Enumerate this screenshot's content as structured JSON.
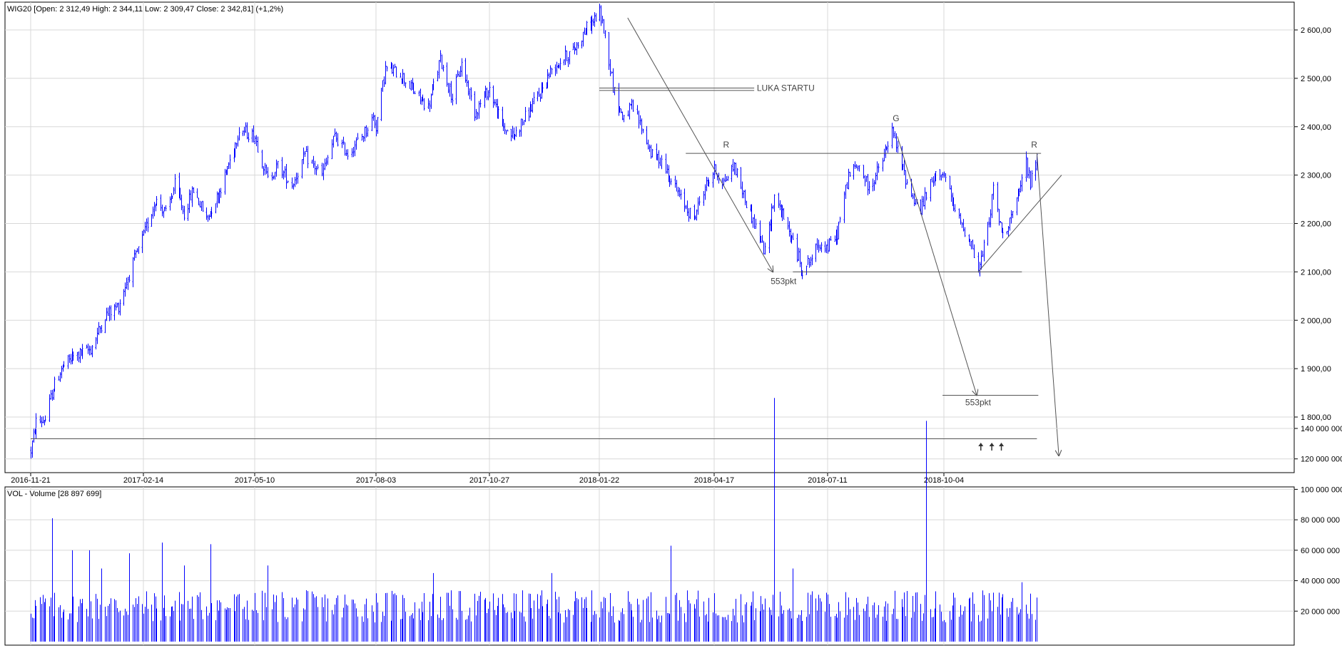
{
  "price_panel": {
    "header": "WIG20 [Open: 2 312,49  High: 2 344,11  Low: 2 309,47  Close: 2 342,81] (+1,2%)"
  },
  "volume_panel": {
    "header": "VOL - Volume [28 897 699]"
  },
  "colors": {
    "series": "#0000ff",
    "grid": "#d8d8d8",
    "annotation_line": "#555555",
    "frame": "#000000"
  },
  "chart_data": [
    {
      "type": "candlestick",
      "title": "WIG20 [Open: 2 312,49  High: 2 344,11  Low: 2 309,47  Close: 2 342,81] (+1,2%)",
      "x_ticks": [
        "2016-11-21",
        "2017-02-14",
        "2017-05-10",
        "2017-08-03",
        "2017-10-27",
        "2018-01-22",
        "2018-04-17",
        "2018-07-11",
        "2018-10-04"
      ],
      "y_ticks": [
        1800,
        1900,
        2000,
        2100,
        2200,
        2300,
        2400,
        2500,
        2600
      ],
      "y_tick_labels": [
        "1 800,00",
        "1 900,00",
        "2 000,00",
        "2 100,00",
        "2 200,00",
        "2 300,00",
        "2 400,00",
        "2 500,00",
        "2 600,00"
      ],
      "ylim": [
        1690,
        2665
      ],
      "grid": true,
      "last_bar": {
        "date": "2018-12-11",
        "open": 2312.49,
        "high": 2344.11,
        "low": 2309.47,
        "close": 2342.81,
        "change_pct": "+1,2%"
      },
      "path_anchors": [
        [
          "2016-11-21",
          1730
        ],
        [
          "2016-11-25",
          1790
        ],
        [
          "2016-12-02",
          1795
        ],
        [
          "2016-12-08",
          1860
        ],
        [
          "2016-12-14",
          1900
        ],
        [
          "2016-12-23",
          1925
        ],
        [
          "2017-01-05",
          1940
        ],
        [
          "2017-01-16",
          2010
        ],
        [
          "2017-01-26",
          2030
        ],
        [
          "2017-02-01",
          2080
        ],
        [
          "2017-02-14",
          2175
        ],
        [
          "2017-02-23",
          2250
        ],
        [
          "2017-03-03",
          2220
        ],
        [
          "2017-03-10",
          2280
        ],
        [
          "2017-03-17",
          2220
        ],
        [
          "2017-03-24",
          2270
        ],
        [
          "2017-04-03",
          2210
        ],
        [
          "2017-04-12",
          2260
        ],
        [
          "2017-04-21",
          2330
        ],
        [
          "2017-04-28",
          2395
        ],
        [
          "2017-05-10",
          2380
        ],
        [
          "2017-05-19",
          2290
        ],
        [
          "2017-05-26",
          2320
        ],
        [
          "2017-06-05",
          2280
        ],
        [
          "2017-06-14",
          2340
        ],
        [
          "2017-06-26",
          2300
        ],
        [
          "2017-07-05",
          2380
        ],
        [
          "2017-07-14",
          2345
        ],
        [
          "2017-07-24",
          2380
        ],
        [
          "2017-08-01",
          2420
        ],
        [
          "2017-08-03",
          2400
        ],
        [
          "2017-08-10",
          2520
        ],
        [
          "2017-08-21",
          2510
        ],
        [
          "2017-09-01",
          2470
        ],
        [
          "2017-09-11",
          2440
        ],
        [
          "2017-09-20",
          2540
        ],
        [
          "2017-09-29",
          2460
        ],
        [
          "2017-10-06",
          2530
        ],
        [
          "2017-10-16",
          2430
        ],
        [
          "2017-10-27",
          2480
        ],
        [
          "2017-11-06",
          2400
        ],
        [
          "2017-11-15",
          2380
        ],
        [
          "2017-11-24",
          2420
        ],
        [
          "2017-12-06",
          2470
        ],
        [
          "2017-12-15",
          2520
        ],
        [
          "2018-01-02",
          2560
        ],
        [
          "2018-01-11",
          2600
        ],
        [
          "2018-01-22",
          2635
        ],
        [
          "2018-01-26",
          2590
        ],
        [
          "2018-02-02",
          2470
        ],
        [
          "2018-02-08",
          2420
        ],
        [
          "2018-02-15",
          2440
        ],
        [
          "2018-02-22",
          2400
        ],
        [
          "2018-03-02",
          2340
        ],
        [
          "2018-03-09",
          2330
        ],
        [
          "2018-03-16",
          2290
        ],
        [
          "2018-03-23",
          2250
        ],
        [
          "2018-04-02",
          2210
        ],
        [
          "2018-04-09",
          2270
        ],
        [
          "2018-04-17",
          2310
        ],
        [
          "2018-04-24",
          2285
        ],
        [
          "2018-05-02",
          2320
        ],
        [
          "2018-05-10",
          2250
        ],
        [
          "2018-05-17",
          2200
        ],
        [
          "2018-05-25",
          2140
        ],
        [
          "2018-06-01",
          2260
        ],
        [
          "2018-06-08",
          2210
        ],
        [
          "2018-06-15",
          2160
        ],
        [
          "2018-06-22",
          2105
        ],
        [
          "2018-06-29",
          2130
        ],
        [
          "2018-07-05",
          2160
        ],
        [
          "2018-07-11",
          2150
        ],
        [
          "2018-07-18",
          2180
        ],
        [
          "2018-07-26",
          2300
        ],
        [
          "2018-08-03",
          2320
        ],
        [
          "2018-08-10",
          2270
        ],
        [
          "2018-08-20",
          2330
        ],
        [
          "2018-08-27",
          2390
        ],
        [
          "2018-09-03",
          2320
        ],
        [
          "2018-09-10",
          2260
        ],
        [
          "2018-09-17",
          2230
        ],
        [
          "2018-09-24",
          2280
        ],
        [
          "2018-10-01",
          2310
        ],
        [
          "2018-10-04",
          2300
        ],
        [
          "2018-10-11",
          2230
        ],
        [
          "2018-10-18",
          2190
        ],
        [
          "2018-10-24",
          2160
        ],
        [
          "2018-10-29",
          2100
        ],
        [
          "2018-11-05",
          2190
        ],
        [
          "2018-11-09",
          2270
        ],
        [
          "2018-11-15",
          2180
        ],
        [
          "2018-11-20",
          2200
        ],
        [
          "2018-11-27",
          2250
        ],
        [
          "2018-12-03",
          2330
        ],
        [
          "2018-12-06",
          2280
        ],
        [
          "2018-12-11",
          2342.81
        ]
      ],
      "annotations": {
        "labels": [
          "LUKA STARTU",
          "R",
          "553pkt",
          "G",
          "553pkt",
          "R"
        ],
        "lines": [
          {
            "kind": "hline",
            "y": 2480,
            "from": "2018-01-22",
            "to": "2018-05-17"
          },
          {
            "kind": "hline",
            "y": 2475,
            "from": "2018-01-22",
            "to": "2018-05-17"
          },
          {
            "kind": "hline",
            "y": 2345,
            "from": "2018-03-27",
            "to": "2018-12-14"
          },
          {
            "kind": "hline",
            "y": 2100,
            "from": "2018-06-15",
            "to": "2018-11-30"
          },
          {
            "kind": "hline",
            "y": 1845,
            "from": "2018-10-03",
            "to": "2018-12-12"
          },
          {
            "kind": "hline",
            "y": 1755,
            "from": "2016-11-21",
            "to": "2018-12-11"
          },
          {
            "kind": "line",
            "from": [
              "2018-02-12",
              2625
            ],
            "to": [
              "2018-05-31",
              2100
            ],
            "arrow": true
          },
          {
            "kind": "line",
            "from": [
              "2018-08-31",
              2380
            ],
            "to": [
              "2018-10-28",
              1845
            ],
            "arrow": true
          },
          {
            "kind": "line",
            "from": [
              "2018-12-11",
              2345
            ],
            "to": [
              "2018-12-27",
              1720
            ],
            "arrow": true
          },
          {
            "kind": "line",
            "from": [
              "2018-10-29",
              2100
            ],
            "to": [
              "2018-12-29",
              2300
            ],
            "arrow": false
          }
        ],
        "up_arrows": [
          "2018-10-31",
          "2018-11-08",
          "2018-11-15"
        ]
      }
    },
    {
      "type": "bar",
      "title": "VOL - Volume [28 897 699]",
      "x_ticks": [
        "2016-11-21",
        "2017-02-14",
        "2017-05-10",
        "2017-08-03",
        "2017-10-27",
        "2018-01-22",
        "2018-04-17",
        "2018-07-11",
        "2018-10-04"
      ],
      "y_ticks": [
        20000000,
        40000000,
        60000000,
        80000000,
        100000000,
        120000000,
        140000000
      ],
      "y_tick_labels": [
        "20 000 000",
        "40 000 000",
        "60 000 000",
        "80 000 000",
        "100 000 000",
        "120 000 000",
        "140 000 000"
      ],
      "ylim": [
        0,
        162000000
      ],
      "grid": true,
      "typical_volume": 25000000,
      "notable_bars": [
        [
          "2016-12-07",
          81000000
        ],
        [
          "2016-12-22",
          60000000
        ],
        [
          "2017-01-04",
          60000000
        ],
        [
          "2017-01-13",
          48000000
        ],
        [
          "2017-02-03",
          58000000
        ],
        [
          "2017-02-28",
          65000000
        ],
        [
          "2017-03-17",
          50000000
        ],
        [
          "2017-04-06",
          64000000
        ],
        [
          "2017-05-19",
          50000000
        ],
        [
          "2017-09-15",
          45000000
        ],
        [
          "2017-12-15",
          45000000
        ],
        [
          "2018-03-16",
          63000000
        ],
        [
          "2018-06-01",
          160000000
        ],
        [
          "2018-06-15",
          48000000
        ],
        [
          "2018-09-21",
          145000000
        ],
        [
          "2018-11-30",
          39000000
        ]
      ],
      "last_bar": {
        "date": "2018-12-11",
        "value": 28897699
      }
    }
  ]
}
